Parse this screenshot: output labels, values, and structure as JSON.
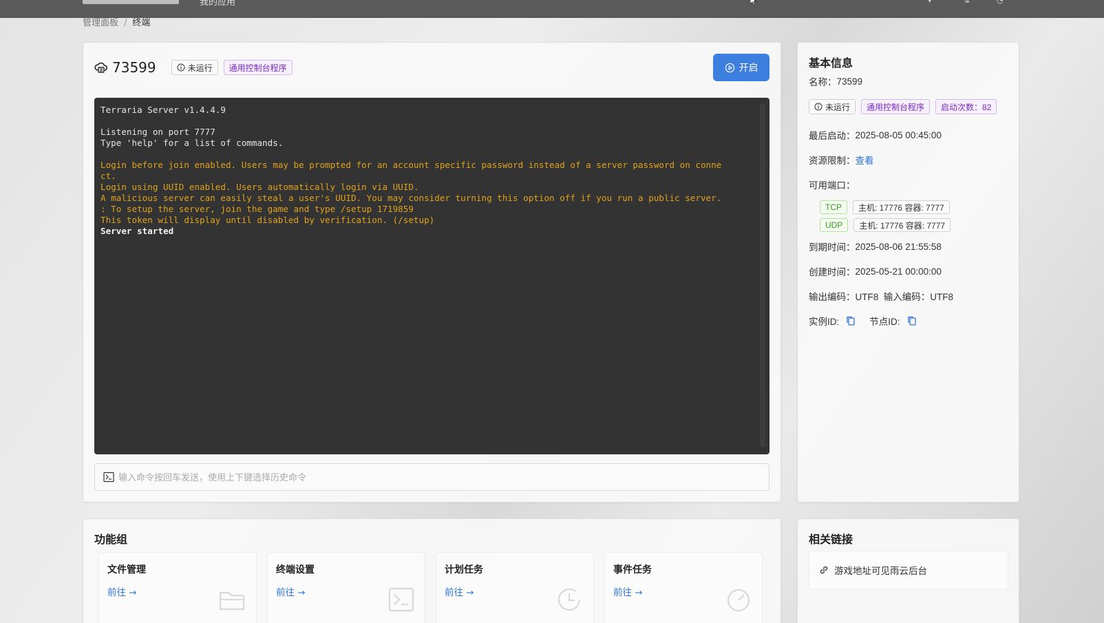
{
  "topbar": {
    "nav_label": "我的应用"
  },
  "breadcrumb": {
    "root": "管理面板",
    "separator": "/",
    "current": "终端"
  },
  "instance": {
    "name": "73599",
    "status_tag": "未运行",
    "type_tag": "通用控制台程序",
    "start_button": "开启"
  },
  "terminal": {
    "lines": [
      {
        "text": "Terraria Server v1.4.4.9",
        "style": "white"
      },
      {
        "text": "",
        "style": "white"
      },
      {
        "text": "Listening on port 7777",
        "style": "white"
      },
      {
        "text": "Type 'help' for a list of commands.",
        "style": "white"
      },
      {
        "text": "",
        "style": "white"
      },
      {
        "text": "Login before join enabled. Users may be prompted for an account specific password instead of a server password on conne",
        "style": "yellow"
      },
      {
        "text": "ct.",
        "style": "yellow"
      },
      {
        "text": "Login using UUID enabled. Users automatically login via UUID.",
        "style": "yellow"
      },
      {
        "text": "A malicious server can easily steal a user's UUID. You may consider turning this option off if you run a public server.",
        "style": "yellow"
      },
      {
        "text": ": To setup the server, join the game and type /setup 1719859",
        "style": "yellow"
      },
      {
        "text": "This token will display until disabled by verification. (/setup)",
        "style": "yellow"
      },
      {
        "text": "Server started",
        "style": "bold"
      }
    ]
  },
  "command": {
    "placeholder": "输入命令按回车发送，使用上下键选择历史命令"
  },
  "info": {
    "title": "基本信息",
    "name_label": "名称：",
    "name_value": "73599",
    "status_tag": "未运行",
    "type_tag": "通用控制台程序",
    "start_count_tag": "启动次数：82",
    "last_start_label": "最后启动：",
    "last_start_value": "2025-08-05 00:45:00",
    "resource_label": "资源限制：",
    "resource_link": "查看",
    "ports_label": "可用端口：",
    "ports": [
      {
        "protocol": "TCP",
        "mapping": "主机: 17776 容器: 7777"
      },
      {
        "protocol": "UDP",
        "mapping": "主机: 17776 容器: 7777"
      }
    ],
    "expire_label": "到期时间：",
    "expire_value": "2025-08-06 21:55:58",
    "created_label": "创建时间：",
    "created_value": "2025-05-21 00:00:00",
    "encoding_text": "输出编码：UTF8  输入编码：UTF8",
    "instance_id_label": "实例ID:",
    "node_id_label": "节点ID:"
  },
  "functions": {
    "title": "功能组",
    "items": [
      {
        "title": "文件管理",
        "link": "前往 →",
        "icon": "folder-icon"
      },
      {
        "title": "终端设置",
        "link": "前往 →",
        "icon": "terminal-icon"
      },
      {
        "title": "计划任务",
        "link": "前往 →",
        "icon": "clock-icon"
      },
      {
        "title": "事件任务",
        "link": "前往 →",
        "icon": "gauge-icon"
      }
    ]
  },
  "links": {
    "title": "相关链接",
    "item": "游戏地址可见雨云后台"
  },
  "colors": {
    "accent": "#3d7fdf",
    "terminal_bg": "#333333",
    "terminal_warn": "#e0a21a",
    "purple_tag": "#7a2cc2",
    "green_tag": "#3a9a23"
  }
}
